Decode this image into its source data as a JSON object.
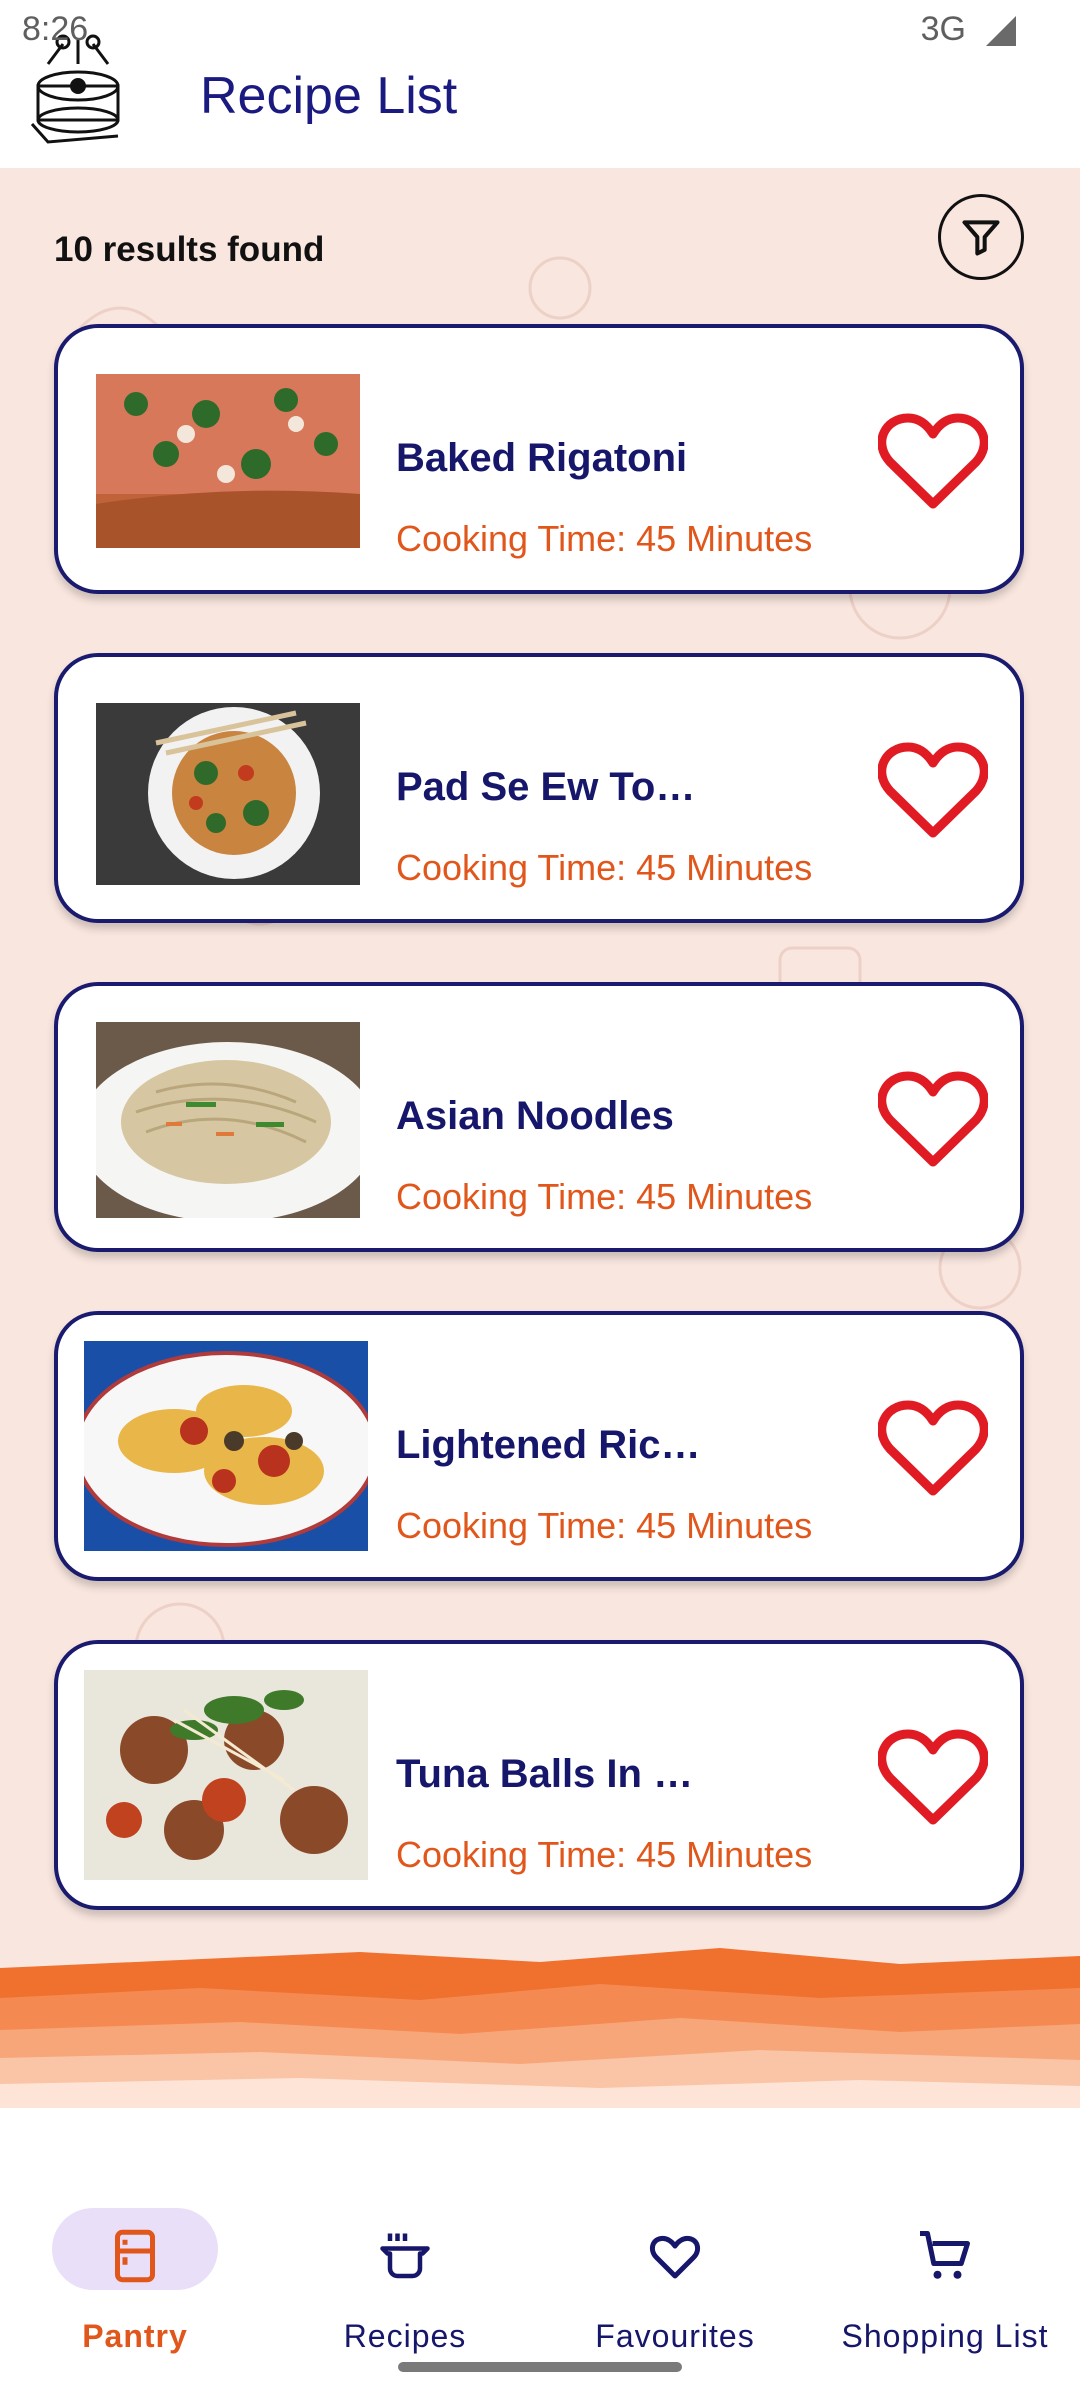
{
  "status_bar": {
    "time": "8:26",
    "network": "3G"
  },
  "app_bar": {
    "title": "Recipe List",
    "logo_icon": "cooking-pot-logo-icon"
  },
  "results": {
    "text": "10 results found",
    "filter_icon": "filter-icon"
  },
  "recipes": [
    {
      "title": "Baked Rigatoni",
      "cooking_time": "Cooking Time: 45 Minutes",
      "favourite_icon": "heart-outline-icon"
    },
    {
      "title": "Pad Se Ew Tofu With V...",
      "cooking_time": "Cooking Time: 45 Minutes",
      "favourite_icon": "heart-outline-icon"
    },
    {
      "title": "Asian Noodles",
      "cooking_time": "Cooking Time: 45 Minutes",
      "favourite_icon": "heart-outline-icon"
    },
    {
      "title": "Lightened Ricotta Stuff...",
      "cooking_time": "Cooking Time: 45 Minutes",
      "favourite_icon": "heart-outline-icon"
    },
    {
      "title": "Tuna Balls In Tomato S...",
      "cooking_time": "Cooking Time: 45 Minutes",
      "favourite_icon": "heart-outline-icon"
    }
  ],
  "bottom_nav": [
    {
      "label": "Pantry",
      "icon": "fridge-icon",
      "active": true
    },
    {
      "label": "Recipes",
      "icon": "pot-icon",
      "active": false
    },
    {
      "label": "Favourites",
      "icon": "heart-icon",
      "active": false
    },
    {
      "label": "Shopping List",
      "icon": "cart-icon",
      "active": false
    }
  ],
  "colors": {
    "primary_text": "#16166b",
    "accent": "#e0561b",
    "heart": "#e01b24",
    "background": "#f9e6df",
    "nav_active_pill": "#eadff8"
  }
}
